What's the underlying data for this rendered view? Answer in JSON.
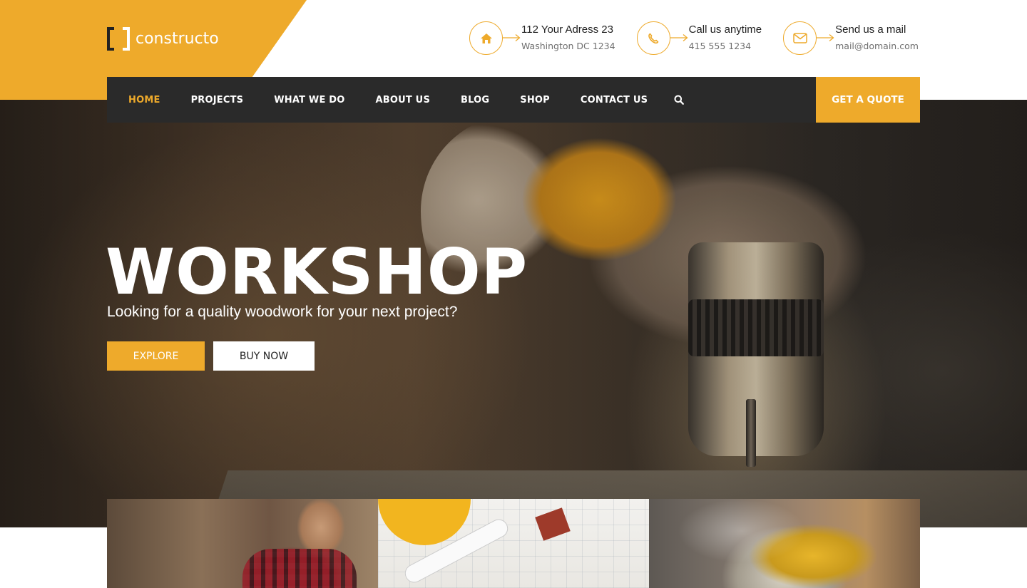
{
  "brand": {
    "logo_text": "constructo",
    "accent_color": "#eeaa2b",
    "dark_color": "#2a2a2a"
  },
  "contacts": [
    {
      "icon": "home-icon",
      "title": "112 Your Adress 23",
      "subtitle": "Washington DC 1234"
    },
    {
      "icon": "phone-icon",
      "title": "Call us anytime",
      "subtitle": "415 555 1234"
    },
    {
      "icon": "envelope-icon",
      "title": "Send us a mail",
      "subtitle": "mail@domain.com"
    }
  ],
  "nav": {
    "items": [
      {
        "label": "HOME",
        "active": true
      },
      {
        "label": "PROJECTS",
        "active": false
      },
      {
        "label": "WHAT WE DO",
        "active": false
      },
      {
        "label": "ABOUT US",
        "active": false
      },
      {
        "label": "BLOG",
        "active": false
      },
      {
        "label": "SHOP",
        "active": false
      },
      {
        "label": "CONTACT US",
        "active": false
      }
    ],
    "search_icon": "search-icon",
    "cta_label": "GET A QUOTE"
  },
  "hero": {
    "title": "WORKSHOP",
    "subtitle": "Looking for a quality woodwork for your next project?",
    "primary_button": "EXPLORE",
    "secondary_button": "BUY NOW"
  }
}
